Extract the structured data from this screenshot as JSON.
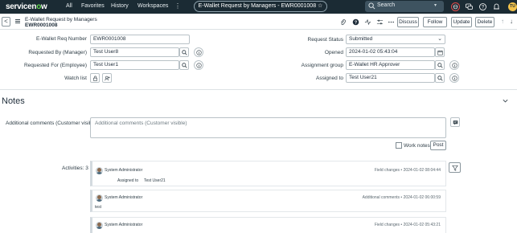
{
  "nav": {
    "logo_a": "servicen",
    "logo_b": "o",
    "logo_c": "w",
    "items": [
      "All",
      "Favorites",
      "History",
      "Workspaces"
    ],
    "more": "⋮",
    "record_title": "E-Wallet Request by Managers - EWR0001008",
    "star": "☆",
    "search_label": "Search",
    "search_caret": "▾",
    "user_initials": "TU",
    "icons": [
      "globe-icon",
      "chat-icon",
      "help-icon",
      "bell-icon"
    ]
  },
  "header": {
    "back": "<",
    "record_type": "E-Wallet Request by Managers",
    "record_number": "EWR0001008",
    "icons": [
      "attachment-icon",
      "help-circle-icon",
      "activity-icon",
      "sliders-icon",
      "more-icon"
    ],
    "buttons": {
      "discuss": "Discuss",
      "follow": "Follow",
      "update": "Update",
      "delete": "Delete"
    },
    "nav_up": "↑",
    "nav_down": "↓"
  },
  "form": {
    "req_number_label": "E-Wallet Req Number",
    "req_number_value": "EWR0001008",
    "requested_by_label": "Requested By (Manager)",
    "requested_by_value": "Test User8",
    "requested_for_label": "Requested For (Employee)",
    "requested_for_value": "Test User1",
    "watch_list_label": "Watch list",
    "status_label": "Request Status",
    "status_value": "Submitted",
    "opened_label": "Opened",
    "opened_value": "2024-01-02 05:43:04",
    "assignment_group_label": "Assignment group",
    "assignment_group_value": "E-Wallet HR Approver",
    "assigned_to_label": "Assigned to",
    "assigned_to_value": "Test User21"
  },
  "notes": {
    "title": "Notes",
    "comments_label": "Additional comments (Customer visible)",
    "comments_placeholder": "Additional comments (Customer visible)",
    "work_notes_label": "Work notes",
    "post_label": "Post",
    "activities_label": "Activities: 3"
  },
  "activities": [
    {
      "author": "System Administrator",
      "kind": "Field changes",
      "timestamp": "2024-01-02 08:04:44",
      "field": "Assigned to",
      "value": "Test User21"
    },
    {
      "author": "System Administrator",
      "kind": "Additional comments",
      "timestamp": "2024-01-02 06:00:59",
      "text": "test"
    },
    {
      "author": "System Administrator",
      "kind": "Field changes",
      "timestamp": "2024-01-02 05:43:21"
    }
  ],
  "colors": {
    "nav_bg": "#1b2b34",
    "logo_accent": "#62d84e"
  }
}
